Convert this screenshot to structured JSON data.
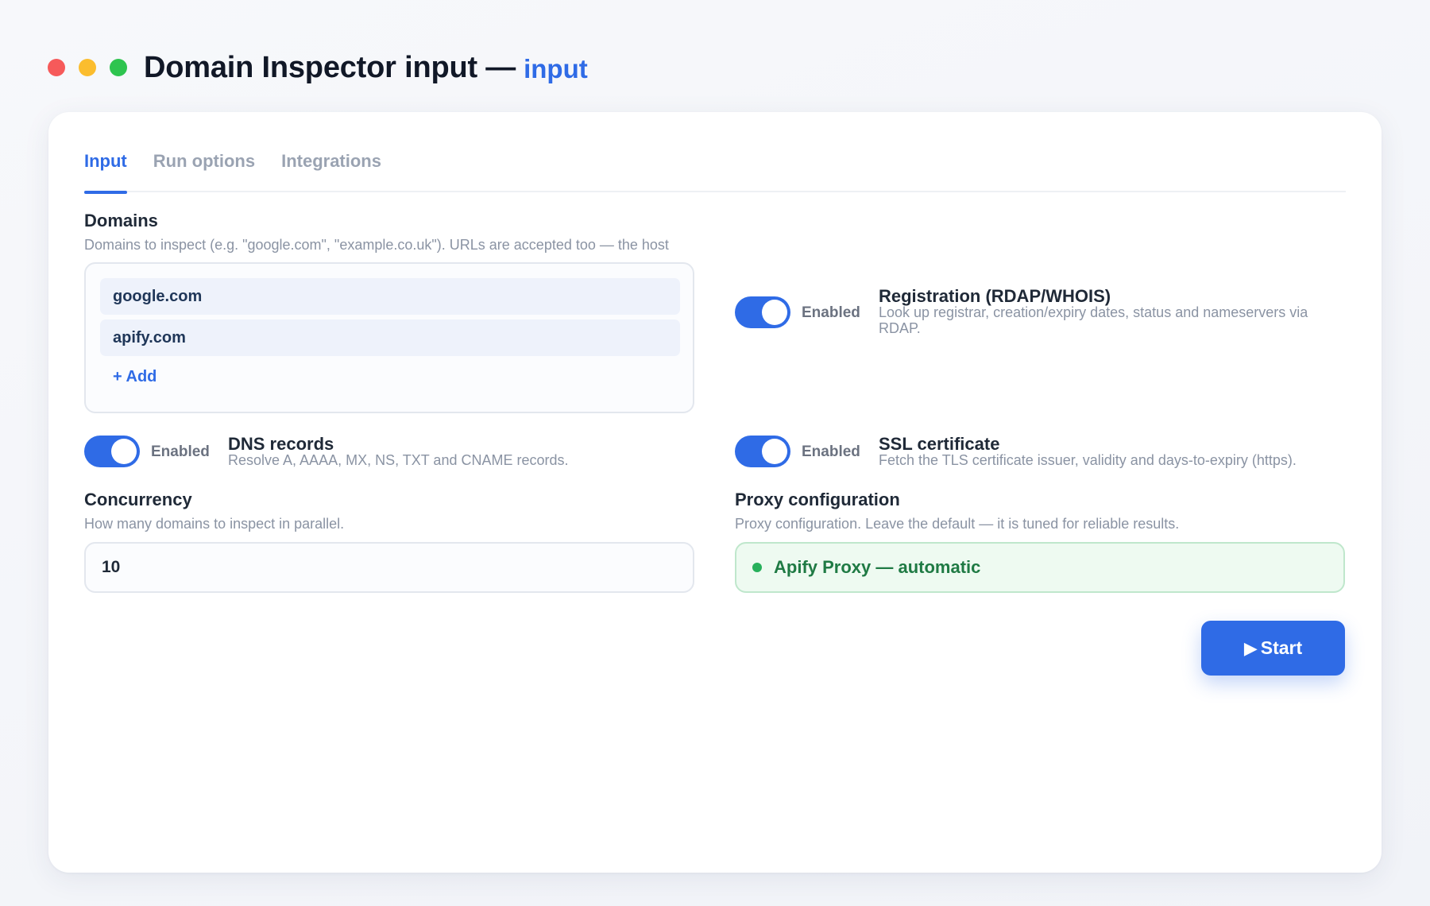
{
  "window": {
    "title": "Domain Inspector input —",
    "title_suffix": "input",
    "controls": [
      "close",
      "minimize",
      "maximize"
    ]
  },
  "tabs": [
    {
      "label": "Input",
      "active": true
    },
    {
      "label": "Run options",
      "active": false
    },
    {
      "label": "Integrations",
      "active": false
    }
  ],
  "domains": {
    "label": "Domains",
    "help": "Domains to inspect (e.g. \"google.com\", \"example.co.uk\"). URLs are accepted too — the host",
    "items": [
      "google.com",
      "apify.com"
    ],
    "add_label": "+ Add"
  },
  "registration": {
    "state": "Enabled",
    "enabled": true,
    "title": "Registration (RDAP/WHOIS)",
    "desc": "Look up registrar, creation/expiry dates, status and nameservers via RDAP."
  },
  "dns": {
    "state": "Enabled",
    "enabled": true,
    "title": "DNS records",
    "desc": "Resolve A, AAAA, MX, NS, TXT and CNAME records."
  },
  "ssl": {
    "state": "Enabled",
    "enabled": true,
    "title": "SSL certificate",
    "desc": "Fetch the TLS certificate issuer, validity and days-to-expiry (https)."
  },
  "concurrency": {
    "label": "Concurrency",
    "help": "How many domains to inspect in parallel.",
    "value": "10"
  },
  "proxy": {
    "label": "Proxy configuration",
    "help": "Proxy configuration. Leave the default — it is tuned for reliable results.",
    "value": "Apify Proxy — automatic"
  },
  "actions": {
    "start_icon": "▶",
    "start_label": "Start"
  },
  "colors": {
    "accent": "#2f6be6",
    "proxy_green": "#1f7a44",
    "close": "#f65a5a",
    "minimize": "#fbbd2e",
    "maximize": "#2ec44f"
  }
}
